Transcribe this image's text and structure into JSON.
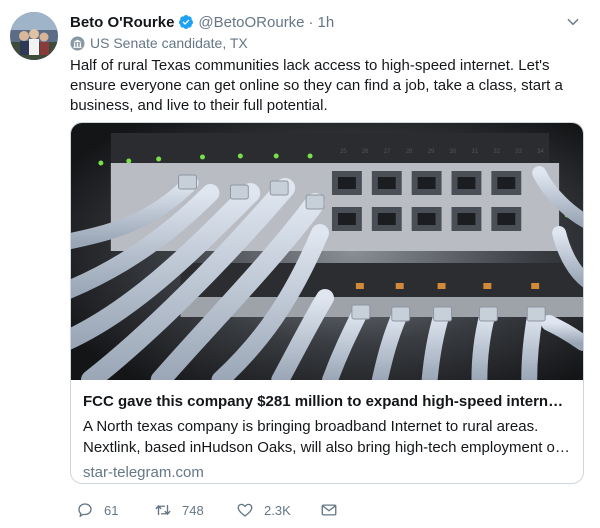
{
  "tweet": {
    "author_name": "Beto O'Rourke",
    "handle": "@BetoORourke",
    "separator": "·",
    "time": "1h",
    "label": "US Senate candidate, TX",
    "text": "Half of rural Texas communities lack access to high-speed internet. Let's ensure everyone can get online so they can find a job, take a class, start a business, and live to their full potential."
  },
  "card": {
    "title": "FCC gave this company $281 million to expand high-speed internet t...",
    "description_line1": "A North texas company is bringing broadband Internet to rural areas.",
    "description_line2": "Nextlink, based inHudson Oaks, will also bring high-tech employment op...",
    "domain": "star-telegram.com",
    "port_numbers": [
      "25",
      "26",
      "27",
      "28",
      "29",
      "30",
      "31",
      "32",
      "33",
      "34"
    ]
  },
  "actions": {
    "replies": "61",
    "retweets": "748",
    "likes": "2.3K"
  },
  "colors": {
    "primary_text": "#14171a",
    "secondary_text": "#657786",
    "verified_blue": "#1da1f2",
    "border": "#ccd6dd"
  },
  "icons": [
    "verified-badge-icon",
    "chevron-down-icon",
    "government-building-icon",
    "reply-icon",
    "retweet-icon",
    "like-icon",
    "direct-message-icon"
  ]
}
